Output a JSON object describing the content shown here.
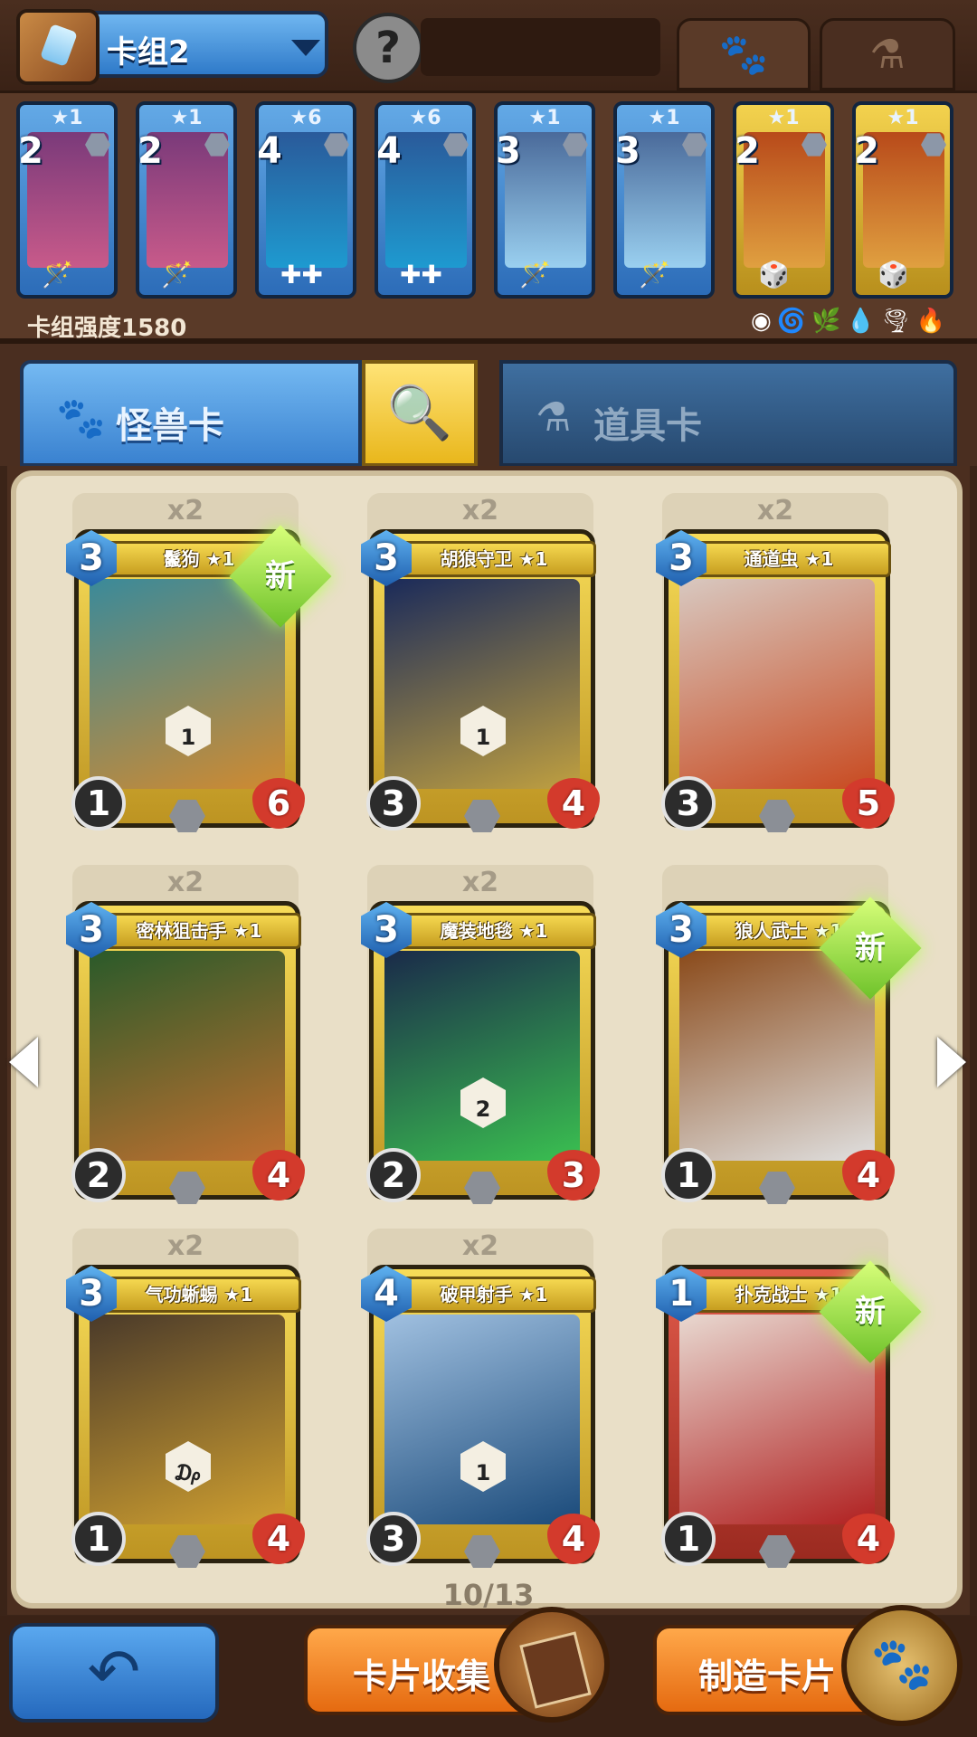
{
  "header": {
    "deck_name": "卡组2",
    "avatar_glyph": "?",
    "tabs": [
      {
        "name": "pets",
        "icon": "paw-icon",
        "glyph": "🐾"
      },
      {
        "name": "items",
        "icon": "potion-icon",
        "glyph": "⚗"
      }
    ]
  },
  "deck": {
    "cards": [
      {
        "stars": "★1",
        "cost": "2",
        "frame": "blue",
        "ability": "🪄",
        "art": [
          "#7a3a7a",
          "#c85a8a"
        ]
      },
      {
        "stars": "★1",
        "cost": "2",
        "frame": "blue",
        "ability": "🪄",
        "art": [
          "#7a3a7a",
          "#c85a8a"
        ]
      },
      {
        "stars": "★6",
        "cost": "4",
        "frame": "blue",
        "ability": "✚✚",
        "art": [
          "#2a5a9a",
          "#1e9ad0"
        ]
      },
      {
        "stars": "★6",
        "cost": "4",
        "frame": "blue",
        "ability": "✚✚",
        "art": [
          "#2a5a9a",
          "#1e9ad0"
        ]
      },
      {
        "stars": "★1",
        "cost": "3",
        "frame": "blue",
        "ability": "🪄",
        "art": [
          "#4a6a9a",
          "#9ad0f0"
        ]
      },
      {
        "stars": "★1",
        "cost": "3",
        "frame": "blue",
        "ability": "🪄",
        "art": [
          "#4a6a9a",
          "#9ad0f0"
        ]
      },
      {
        "stars": "★1",
        "cost": "2",
        "frame": "gold",
        "ability": "🎲",
        "art": [
          "#b84a1a",
          "#e0a040"
        ]
      },
      {
        "stars": "★1",
        "cost": "2",
        "frame": "gold",
        "ability": "🎲",
        "art": [
          "#b84a1a",
          "#e0a040"
        ]
      }
    ],
    "power_label": "卡组强度1580",
    "element_icons": "◉🌀🌿💧🌪🔥"
  },
  "category_tabs": {
    "monster": "怪兽卡",
    "items": "道具卡",
    "search_icon": "🔍"
  },
  "collection": {
    "cards": [
      {
        "qty": "x2",
        "name": "鬣狗 ★1",
        "cost": "3",
        "atk": "1",
        "hp": "6",
        "badge": "1",
        "new": "新",
        "frame": "gold",
        "art": [
          "#3a8a9a",
          "#d08a30"
        ]
      },
      {
        "qty": "x2",
        "name": "胡狼守卫 ★1",
        "cost": "3",
        "atk": "3",
        "hp": "4",
        "badge": "1",
        "new": "",
        "frame": "gold",
        "art": [
          "#1a2a5a",
          "#c0a040"
        ]
      },
      {
        "qty": "x2",
        "name": "通道虫 ★1",
        "cost": "3",
        "atk": "3",
        "hp": "5",
        "badge": "",
        "new": "",
        "frame": "gold",
        "art": [
          "#d8c8c0",
          "#c84a20"
        ]
      },
      {
        "qty": "x2",
        "name": "密林狙击手 ★1",
        "cost": "3",
        "atk": "2",
        "hp": "4",
        "badge": "",
        "new": "",
        "frame": "gold",
        "art": [
          "#2a5a2a",
          "#c07030"
        ]
      },
      {
        "qty": "x2",
        "name": "魔装地毯 ★1",
        "cost": "3",
        "atk": "2",
        "hp": "3",
        "badge": "2",
        "new": "",
        "frame": "gold",
        "art": [
          "#1a2a4a",
          "#3ac050"
        ]
      },
      {
        "qty": "",
        "name": "狼人武士 ★1",
        "cost": "3",
        "atk": "1",
        "hp": "4",
        "badge": "",
        "new": "新",
        "frame": "gold",
        "art": [
          "#8a4a1a",
          "#e0e0e0"
        ]
      },
      {
        "qty": "x2",
        "name": "气功蜥蜴 ★1",
        "cost": "3",
        "atk": "1",
        "hp": "4",
        "badge": "₯",
        "new": "",
        "frame": "gold",
        "art": [
          "#4a3a2a",
          "#d0a030"
        ]
      },
      {
        "qty": "x2",
        "name": "破甲射手 ★1",
        "cost": "4",
        "atk": "3",
        "hp": "4",
        "badge": "1",
        "new": "",
        "frame": "gold",
        "art": [
          "#a0c0e0",
          "#1a4a7a"
        ]
      },
      {
        "qty": "",
        "name": "扑克战士 ★1",
        "cost": "1",
        "atk": "1",
        "hp": "4",
        "badge": "",
        "new": "新",
        "frame": "red",
        "art": [
          "#e8d8d0",
          "#b02020"
        ]
      }
    ],
    "page_indicator": "10/13"
  },
  "bottom": {
    "back_glyph": "↶",
    "collect_label": "卡片收集",
    "craft_label": "制造卡片",
    "craft_glyph": "🐾"
  }
}
